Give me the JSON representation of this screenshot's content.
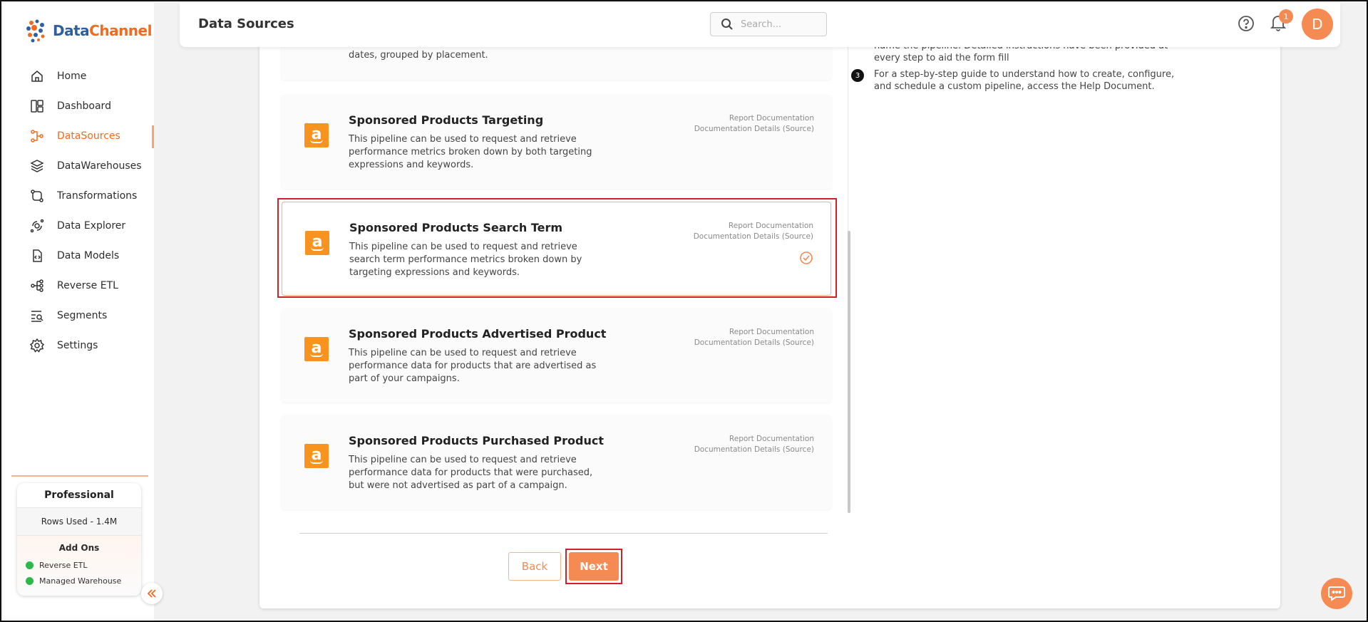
{
  "brand": {
    "name_part1": "Data",
    "name_part2": "Channel"
  },
  "header": {
    "title": "Data Sources",
    "search_placeholder": "Search...",
    "notification_count": "1",
    "avatar_initial": "D"
  },
  "sidebar": {
    "items": [
      {
        "label": "Home",
        "icon": "home-icon"
      },
      {
        "label": "Dashboard",
        "icon": "dashboard-icon"
      },
      {
        "label": "DataSources",
        "icon": "datasources-icon",
        "active": true
      },
      {
        "label": "DataWarehouses",
        "icon": "datawarehouses-icon"
      },
      {
        "label": "Transformations",
        "icon": "transformations-icon"
      },
      {
        "label": "Data Explorer",
        "icon": "data-explorer-icon"
      },
      {
        "label": "Data Models",
        "icon": "data-models-icon"
      },
      {
        "label": "Reverse ETL",
        "icon": "reverse-etl-icon"
      },
      {
        "label": "Segments",
        "icon": "segments-icon"
      },
      {
        "label": "Settings",
        "icon": "settings-icon"
      }
    ],
    "plan": {
      "title": "Professional",
      "rows_used": "Rows Used - 1.4M",
      "addons_title": "Add Ons",
      "addons": [
        "Reverse ETL",
        "Managed Warehouse"
      ]
    }
  },
  "help_panel": {
    "step2_tail_line1": "name the pipeline. Detailed instructions have been provided at",
    "step2_tail_line2": "every step to aid the form fill",
    "step3_num": "3",
    "step3_line1": "For a step-by-step guide to understand how to create, configure,",
    "step3_line2": "and schedule a custom pipeline, access the Help Document."
  },
  "partial_card_desc": "dates, grouped by placement.",
  "cards": [
    {
      "title": "Sponsored Products Targeting",
      "desc": "This pipeline can be used to request and retrieve performance metrics broken down by both targeting expressions and keywords.",
      "link1": "Report Documentation",
      "link2": "Documentation Details (Source)",
      "selected": false
    },
    {
      "title": "Sponsored Products Search Term",
      "desc": "This pipeline can be used to request and retrieve search term performance metrics broken down by targeting expressions and keywords.",
      "link1": "Report Documentation",
      "link2": "Documentation Details (Source)",
      "selected": true
    },
    {
      "title": "Sponsored Products Advertised Product",
      "desc": "This pipeline can be used to request and retrieve performance data for products that are advertised as part of your campaigns.",
      "link1": "Report Documentation",
      "link2": "Documentation Details (Source)",
      "selected": false
    },
    {
      "title": "Sponsored Products Purchased Product",
      "desc": "This pipeline can be used to request and retrieve performance data for products that were purchased, but were not advertised as part of a campaign.",
      "link1": "Report Documentation",
      "link2": "Documentation Details (Source)",
      "selected": false
    }
  ],
  "buttons": {
    "back": "Back",
    "next": "Next"
  },
  "colors": {
    "accent": "#f58a52",
    "brand_orange": "#f26a21",
    "brand_blue": "#2f5f9e",
    "highlight": "#d0202a",
    "amazon": "#f7931e"
  }
}
